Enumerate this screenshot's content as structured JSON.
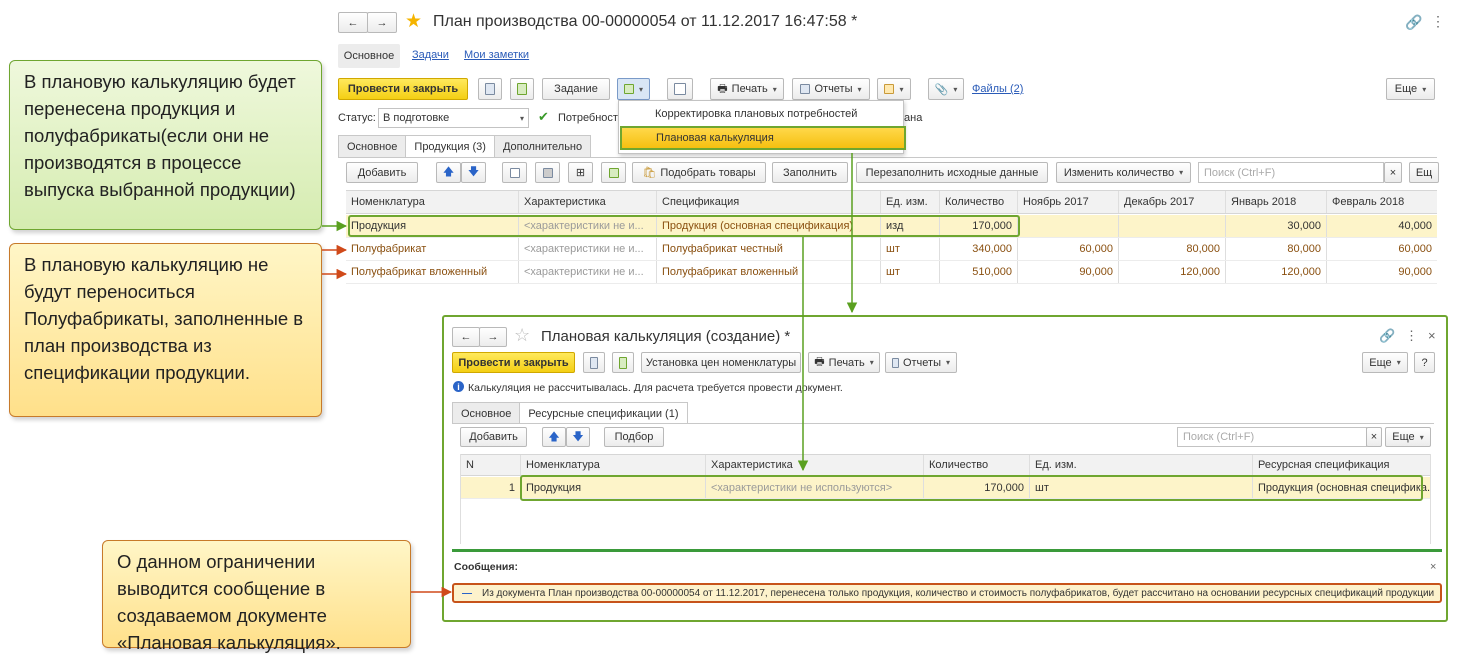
{
  "main": {
    "title": "План производства 00-00000054 от 11.12.2017 16:47:58 *",
    "nav_tabs": [
      "Основное",
      "Задачи",
      "Мои заметки"
    ],
    "toolbar": {
      "post_close": "Провести и закрыть",
      "task": "Задание",
      "print": "Печать",
      "reports": "Отчеты",
      "files": "Файлы (2)",
      "more": "Еще"
    },
    "status_label": "Статус:",
    "status_value": "В подготовке",
    "needs_label": "Потребност",
    "needs_tail": "ана",
    "dropdown": {
      "items": [
        "Корректировка плановых потребностей",
        "Плановая калькуляция"
      ]
    },
    "tabs": [
      "Основное",
      "Продукция (3)",
      "Дополнительно"
    ],
    "grid_toolbar": {
      "add": "Добавить",
      "pick": "Подобрать товары",
      "fill": "Заполнить",
      "refill": "Перезаполнить исходные данные",
      "change_qty": "Изменить количество",
      "search_placeholder": "Поиск (Ctrl+F)",
      "more": "Ещ"
    },
    "columns": [
      "Номенклатура",
      "Характеристика",
      "Спецификация",
      "Ед. изм.",
      "Количество",
      "Ноябрь 2017",
      "Декабрь 2017",
      "Январь 2018",
      "Февраль 2018"
    ],
    "rows": [
      {
        "item": "Продукция",
        "char": "<характеристики не и...",
        "spec": "Продукция (основная спецификация)",
        "unit": "изд",
        "qty": "170,000",
        "nov": "",
        "dec": "",
        "jan": "30,000",
        "feb": "40,000"
      },
      {
        "item": "Полуфабрикат",
        "char": "<характеристики не и...",
        "spec": "Полуфабрикат честный",
        "unit": "шт",
        "qty": "340,000",
        "nov": "60,000",
        "dec": "80,000",
        "jan": "80,000",
        "feb": "60,000"
      },
      {
        "item": "Полуфабрикат вложенный",
        "char": "<характеристики не и...",
        "spec": "Полуфабрикат вложенный",
        "unit": "шт",
        "qty": "510,000",
        "nov": "90,000",
        "dec": "120,000",
        "jan": "120,000",
        "feb": "90,000"
      }
    ]
  },
  "sub": {
    "title": "Плановая калькуляция (создание) *",
    "toolbar": {
      "post_close": "Провести и закрыть",
      "set_prices": "Установка цен номенклатуры",
      "print": "Печать",
      "reports": "Отчеты",
      "more": "Еще",
      "help": "?"
    },
    "info": "Калькуляция не рассчитывалась. Для расчета требуется провести документ.",
    "tabs": [
      "Основное",
      "Ресурсные спецификации (1)"
    ],
    "grid_toolbar": {
      "add": "Добавить",
      "pick": "Подбор",
      "search_placeholder": "Поиск (Ctrl+F)",
      "more": "Еще"
    },
    "columns": [
      "N",
      "Номенклатура",
      "Характеристика",
      "Количество",
      "Ед. изм.",
      "Ресурсная спецификация"
    ],
    "rows": [
      {
        "n": "1",
        "item": "Продукция",
        "char": "<характеристики не используются>",
        "qty": "170,000",
        "unit": "шт",
        "spec": "Продукция (основная специфика..."
      }
    ],
    "messages_label": "Сообщения:",
    "message": "Из документа План производства 00-00000054 от 11.12.2017, перенесена только продукция, количество и стоимость полуфабрикатов, будет рассчитано на основании ресурсных спецификаций продукции"
  },
  "callouts": {
    "green": "В плановую калькуляцию будет перенесена продукция и полуфабрикаты(если они не производятся в процессе выпуска выбранной продукции)",
    "orange1": "В плановую калькуляцию не будут переноситься Полуфабрикаты, заполненные в план производства из спецификации продукции.",
    "orange2": "О данном ограничении выводится сообщение в создаваемом документе «Плановая калькуляция»."
  },
  "colors": {
    "accent_yellow": "#f4cf14",
    "highlight_row": "#fdf4c9",
    "callout_green": "#6fa630",
    "callout_orange": "#c77a2a",
    "arrow_red": "#d04a1a"
  }
}
